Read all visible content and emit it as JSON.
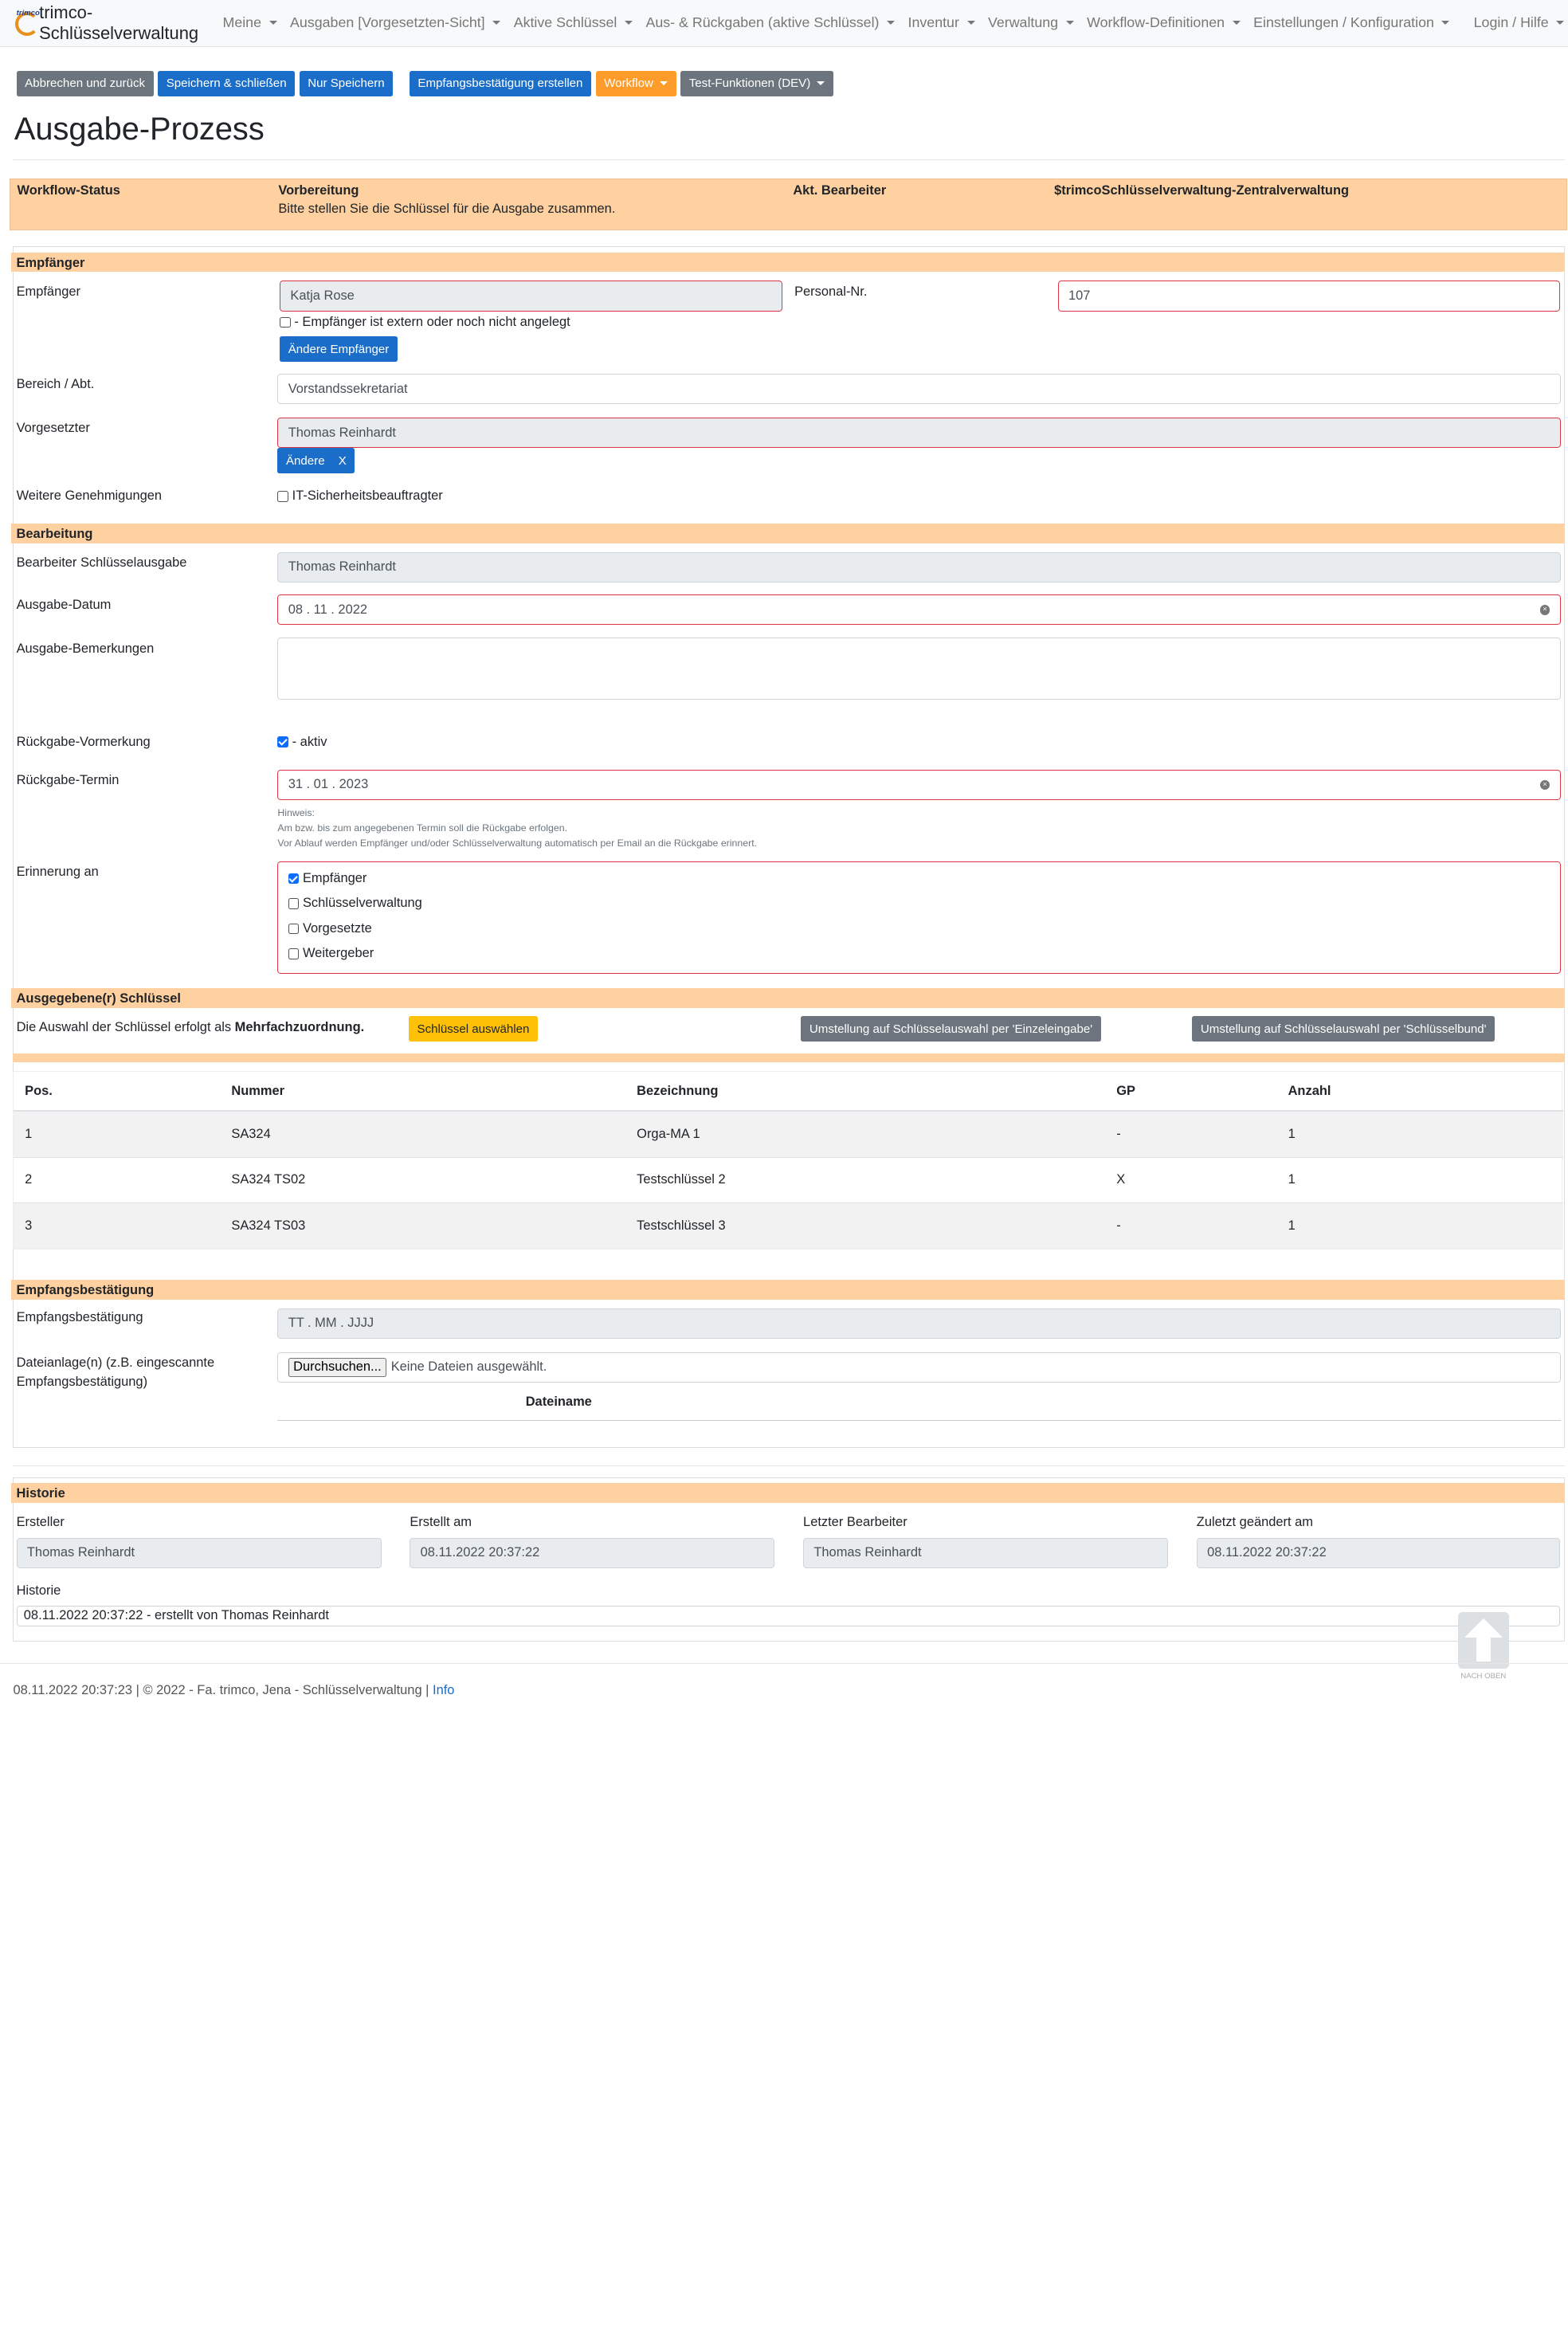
{
  "nav": {
    "brand": "trimco-Schlüsselverwaltung",
    "brand_small": "trimco",
    "items": [
      "Meine",
      "Ausgaben [Vorgesetzten-Sicht]",
      "Aktive Schlüssel",
      "Aus- & Rückgaben (aktive Schlüssel)",
      "Inventur",
      "Verwaltung",
      "Workflow-Definitionen",
      "Einstellungen / Konfiguration"
    ],
    "right": "Login / Hilfe"
  },
  "toolbar": {
    "cancel": "Abbrechen und zurück",
    "save_close": "Speichern & schließen",
    "save_only": "Nur Speichern",
    "receipt": "Empfangsbestätigung erstellen",
    "workflow": "Workflow",
    "test": "Test-Funktionen (DEV)"
  },
  "page_title": "Ausgabe-Prozess",
  "status": {
    "label": "Workflow-Status",
    "value": "Vorbereitung",
    "hint": "Bitte stellen Sie die Schlüssel für die Ausgabe zusammen.",
    "editor_label": "Akt. Bearbeiter",
    "editor_value": "$trimcoSchlüsselverwaltung-Zentralverwaltung"
  },
  "empfaenger": {
    "section": "Empfänger",
    "label": "Empfänger",
    "value": "Katja Rose",
    "extern_label": "- Empfänger ist extern oder noch nicht angelegt",
    "change_btn": "Ändere Empfänger",
    "personal_label": "Personal-Nr.",
    "personal_value": "107",
    "bereich_label": "Bereich / Abt.",
    "bereich_value": "Vorstandssekretariat",
    "vorgesetzter_label": "Vorgesetzter",
    "vorgesetzter_value": "Thomas Reinhardt",
    "aendere_btn": "Ändere",
    "x_btn": "X",
    "genehmigungen_label": "Weitere Genehmigungen",
    "genehmigungen_option": "IT-Sicherheitsbeauftragter"
  },
  "bearbeitung": {
    "section": "Bearbeitung",
    "bearbeiter_label": "Bearbeiter Schlüsselausgabe",
    "bearbeiter_value": "Thomas Reinhardt",
    "datum_label": "Ausgabe-Datum",
    "datum_value": "08 . 11 . 2022",
    "bemerkungen_label": "Ausgabe-Bemerkungen",
    "vormerkung_label": "Rückgabe-Vormerkung",
    "vormerkung_option": "- aktiv",
    "termin_label": "Rückgabe-Termin",
    "termin_value": "31 . 01 . 2023",
    "hint_1": "Hinweis:",
    "hint_2": "Am bzw. bis zum angegebenen Termin soll die Rückgabe erfolgen.",
    "hint_3": "Vor Ablauf werden Empfänger und/oder Schlüsselverwaltung automatisch per Email an die Rückgabe erinnert.",
    "erinnerung_label": "Erinnerung an",
    "erinnerung_options": [
      "Empfänger",
      "Schlüsselverwaltung",
      "Vorgesetzte",
      "Weitergeber"
    ]
  },
  "schluessel": {
    "section": "Ausgegebene(r) Schlüssel",
    "info_pre": "Die Auswahl der Schlüssel erfolgt als ",
    "info_bold": "Mehrfachzuordnung.",
    "select_btn": "Schlüssel auswählen",
    "einzel_btn": "Umstellung auf Schlüsselauswahl per 'Einzeleingabe'",
    "bund_btn": "Umstellung auf Schlüsselauswahl per 'Schlüsselbund'",
    "columns": [
      "Pos.",
      "Nummer",
      "Bezeichnung",
      "GP",
      "Anzahl"
    ],
    "rows": [
      [
        "1",
        "SA324",
        "Orga-MA 1",
        "-",
        "1"
      ],
      [
        "2",
        "SA324 TS02",
        "Testschlüssel 2",
        "X",
        "1"
      ],
      [
        "3",
        "SA324 TS03",
        "Testschlüssel 3",
        "-",
        "1"
      ]
    ]
  },
  "empfangsbestaetigung": {
    "section": "Empfangsbestätigung",
    "label": "Empfangsbestätigung",
    "placeholder": "TT . MM . JJJJ",
    "datei_label_1": "Dateianlage(n) (z.B. eingescannte",
    "datei_label_2": "Empfangsbestätigung)",
    "browse_btn": "Durchsuchen...",
    "no_file": "Keine Dateien ausgewählt.",
    "dateiname_header": "Dateiname"
  },
  "historie": {
    "section": "Historie",
    "ersteller_label": "Ersteller",
    "ersteller_value": "Thomas Reinhardt",
    "erstellt_label": "Erstellt am",
    "erstellt_value": "08.11.2022 20:37:22",
    "letzter_label": "Letzter Bearbeiter",
    "letzter_value": "Thomas Reinhardt",
    "geaendert_label": "Zuletzt geändert am",
    "geaendert_value": "08.11.2022 20:37:22",
    "historie_label": "Historie",
    "historie_value": "08.11.2022 20:37:22 - erstellt von Thomas Reinhardt"
  },
  "back_to_top": "NACH OBEN",
  "footer": {
    "text": "08.11.2022 20:37:23 | © 2022 - Fa. trimco, Jena - Schlüsselverwaltung | ",
    "link": "Info"
  },
  "colors": {
    "section_bg": "#ffd0a0",
    "primary": "#1a6dc8",
    "secondary": "#6c757d",
    "warning": "#fd9c2a",
    "error_border": "#dc3545"
  }
}
